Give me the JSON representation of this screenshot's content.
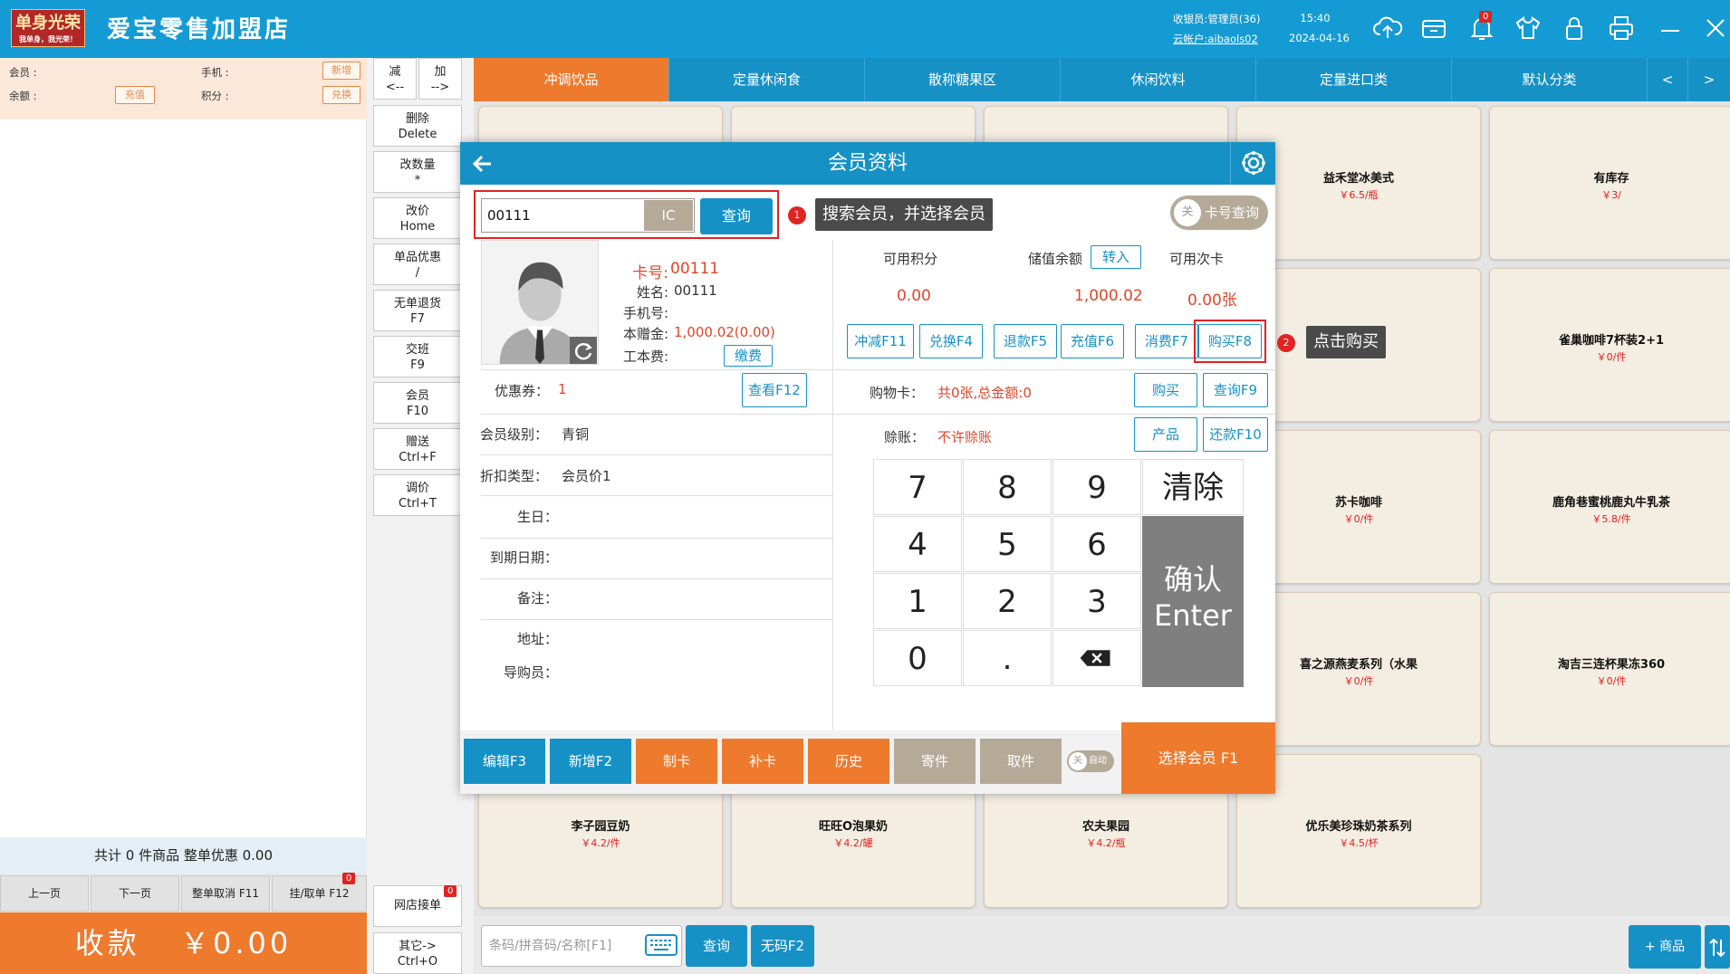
{
  "topbar": {
    "logo_text": "单身光荣",
    "logo_sub": "我单身，我光荣！",
    "store_name": "爱宝零售加盟店",
    "cashier": "收银员:管理员(36)",
    "cloud_account": "云帐户:aibaols02",
    "time": "15:40",
    "date": "2024-04-16",
    "notify_count": "0",
    "icons": [
      "cloud-upload-icon",
      "cash-drawer-icon",
      "bell-icon",
      "shirt-icon",
      "lock-icon",
      "printer-icon",
      "minimize-icon",
      "close-icon"
    ]
  },
  "left": {
    "member_label": "会员 :",
    "phone_label": "手机 :",
    "add_label": "新增",
    "balance_label": "余额 :",
    "recharge_label": "充值",
    "points_label": "积分 :",
    "exchange_label": "兑换",
    "total_text": "共计 0 件商品 整单优惠 0.00",
    "prev_page": "上一页",
    "next_page": "下一页",
    "cancel_order": "整单取消 F11",
    "hold_order": "挂/取单 F12",
    "hold_count": "0",
    "pay_label": "收款",
    "pay_amount": "￥0.00"
  },
  "shortcuts": {
    "minus_top": "减",
    "minus_bottom": "<--",
    "plus_top": "加",
    "plus_bottom": "-->",
    "items": [
      {
        "top": "删除",
        "bottom": "Delete"
      },
      {
        "top": "改数量",
        "bottom": "*"
      },
      {
        "top": "改价",
        "bottom": "Home"
      },
      {
        "top": "单品优惠",
        "bottom": "/"
      },
      {
        "top": "无单退货",
        "bottom": "F7"
      },
      {
        "top": "交班",
        "bottom": "F9"
      },
      {
        "top": "会员",
        "bottom": "F10"
      },
      {
        "top": "赠送",
        "bottom": "Ctrl+F"
      },
      {
        "top": "调价",
        "bottom": "Ctrl+T"
      }
    ],
    "online_orders": "网店接单",
    "online_count": "0",
    "other_top": "其它->",
    "other_bottom": "Ctrl+O"
  },
  "categories": [
    "冲调饮品",
    "定量休闲食",
    "散称糖果区",
    "休闲饮料",
    "定量进口类",
    "默认分类"
  ],
  "cat_prev": "<",
  "cat_next": ">",
  "products": [
    {
      "name": "益禾堂冰美式",
      "price": "￥6.5/瓶"
    },
    {
      "name": "有库存",
      "price": "￥3/"
    },
    {
      "name": "雀巢咖啡7杯装2+1",
      "price": "￥0/件"
    },
    {
      "name": "苏卡咖啡",
      "price": "￥0/件"
    },
    {
      "name": "鹿角巷蜜桃鹿丸牛乳茶",
      "price": "￥5.8/件"
    },
    {
      "name": "喜之源燕麦系列（水果",
      "price": "￥0/件"
    },
    {
      "name": "淘吉三连杯果冻360",
      "price": "￥0/件"
    },
    {
      "name": "李子园豆奶",
      "price": "￥4.2/件"
    },
    {
      "name": "旺旺O泡果奶",
      "price": "￥4.2/罐"
    },
    {
      "name": "农夫果园",
      "price": "￥4.2/瓶"
    },
    {
      "name": "优乐美珍珠奶茶系列",
      "price": "￥4.5/杯"
    }
  ],
  "bottom": {
    "search_placeholder": "条码/拼音码/名称[F1]",
    "query": "查询",
    "no_code": "无码F2",
    "add_product": "+ 商品"
  },
  "modal": {
    "title": "会员资料",
    "search_value": "00111",
    "ic_label": "IC",
    "query_label": "查询",
    "step1": "1",
    "tip1": "搜索会员，并选择会员",
    "card_toggle": "关",
    "card_query": "卡号查询",
    "card_no_label": "卡号:",
    "card_no": "00111",
    "name_label": "姓名:",
    "name": "00111",
    "phone_label": "手机号:",
    "gift_label": "本赠金:",
    "gift_value": "1,000.02(0.00)",
    "fee_label": "工本费:",
    "pay_fee": "缴费",
    "points_title": "可用积分",
    "balance_title": "储值余额",
    "transfer_in": "转入",
    "times_title": "可用次卡",
    "points_value": "0.00",
    "balance_value": "1,000.02",
    "times_value": "0.00张",
    "actions": [
      "冲减F11",
      "兑换F4",
      "退款F5",
      "充值F6",
      "消费F7"
    ],
    "buy_label": "购买F8",
    "step2": "2",
    "tip2": "点击购买",
    "coupon_label": "优惠券：",
    "coupon_value": "1",
    "view_coupon": "查看F12",
    "shopcard_label": "购物卡：",
    "shopcard_value": "共0张,总金额:0",
    "buy_card": "购买",
    "query_card": "查询F9",
    "level_label": "会员级别：",
    "level_value": "青铜",
    "credit_label": "赊账：",
    "credit_value": "不许赊账",
    "product_btn": "产品",
    "repay_btn": "还款F10",
    "discount_label": "折扣类型：",
    "discount_value": "会员价1",
    "birthday_label": "生日：",
    "expire_label": "到期日期：",
    "note_label": "备注：",
    "address_label": "地址：",
    "guide_label": "导购员：",
    "keys": [
      "7",
      "8",
      "9",
      "4",
      "5",
      "6",
      "1",
      "2",
      "3",
      "0",
      "."
    ],
    "clear_label": "清除",
    "confirm_label": "确认",
    "enter_label": "Enter",
    "footer": [
      "编辑F3",
      "新增F2",
      "制卡",
      "补卡",
      "历史",
      "寄件",
      "取件"
    ],
    "auto_toggle": "关",
    "auto_label": "自动",
    "select_member": "选择会员 F1"
  }
}
